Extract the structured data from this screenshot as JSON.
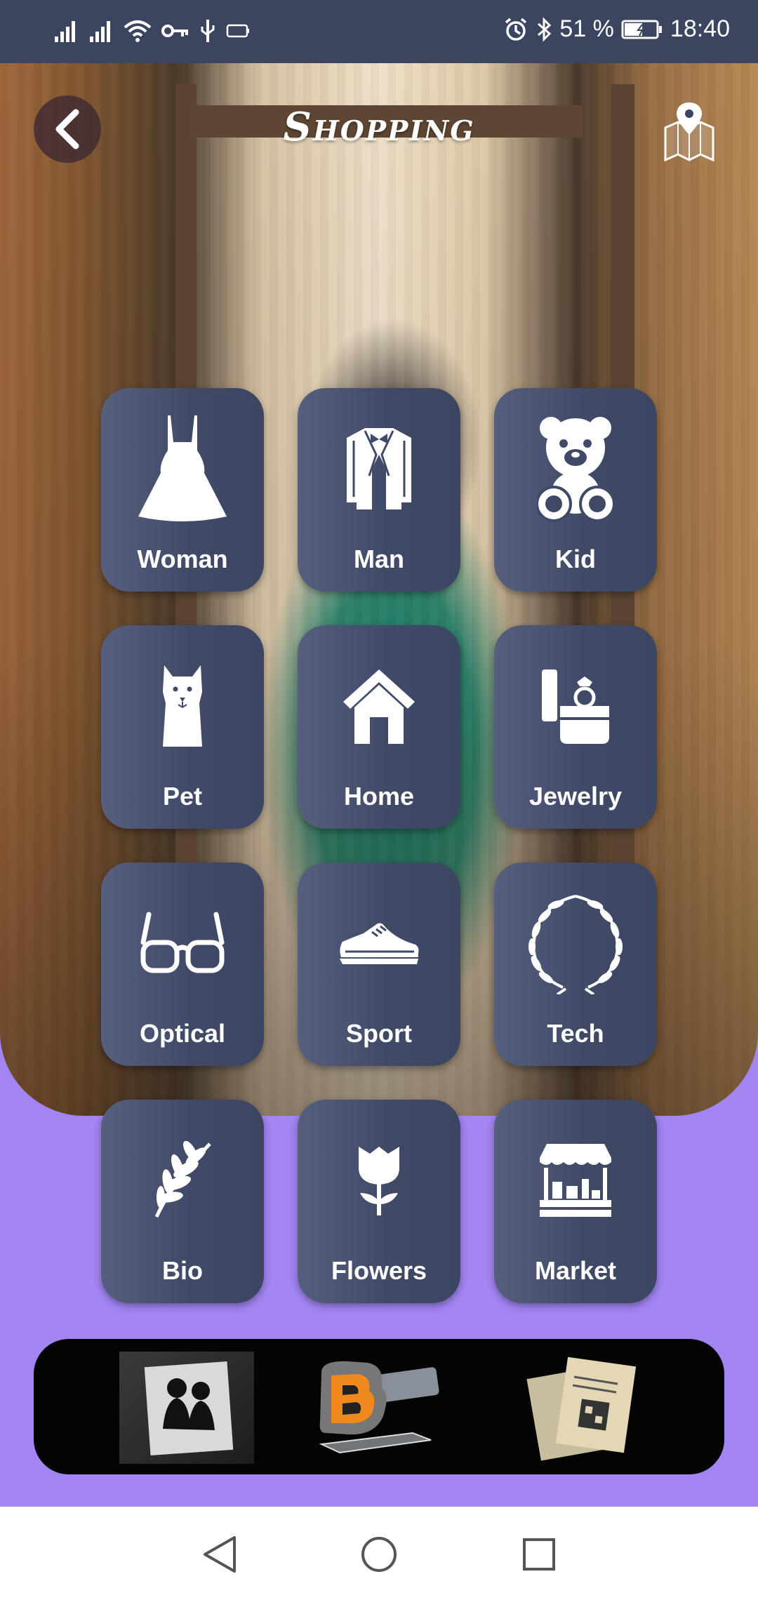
{
  "status": {
    "battery": "51 %",
    "time": "18:40"
  },
  "header": {
    "title": "Shopping"
  },
  "categories": [
    {
      "label": "Woman",
      "icon": "dress-icon"
    },
    {
      "label": "Man",
      "icon": "tuxedo-icon"
    },
    {
      "label": "Kid",
      "icon": "teddy-bear-icon"
    },
    {
      "label": "Pet",
      "icon": "dog-icon"
    },
    {
      "label": "Home",
      "icon": "house-icon"
    },
    {
      "label": "Jewelry",
      "icon": "ring-box-icon"
    },
    {
      "label": "Optical",
      "icon": "glasses-icon"
    },
    {
      "label": "Sport",
      "icon": "sneaker-icon"
    },
    {
      "label": "Tech",
      "icon": "laurel-wreath-icon"
    },
    {
      "label": "Bio",
      "icon": "leaf-icon"
    },
    {
      "label": "Flowers",
      "icon": "tulip-icon"
    },
    {
      "label": "Market",
      "icon": "market-stall-icon"
    }
  ],
  "colors": {
    "tile": "#404a67",
    "background": "#a285f2",
    "statusbar": "#3c4560"
  }
}
